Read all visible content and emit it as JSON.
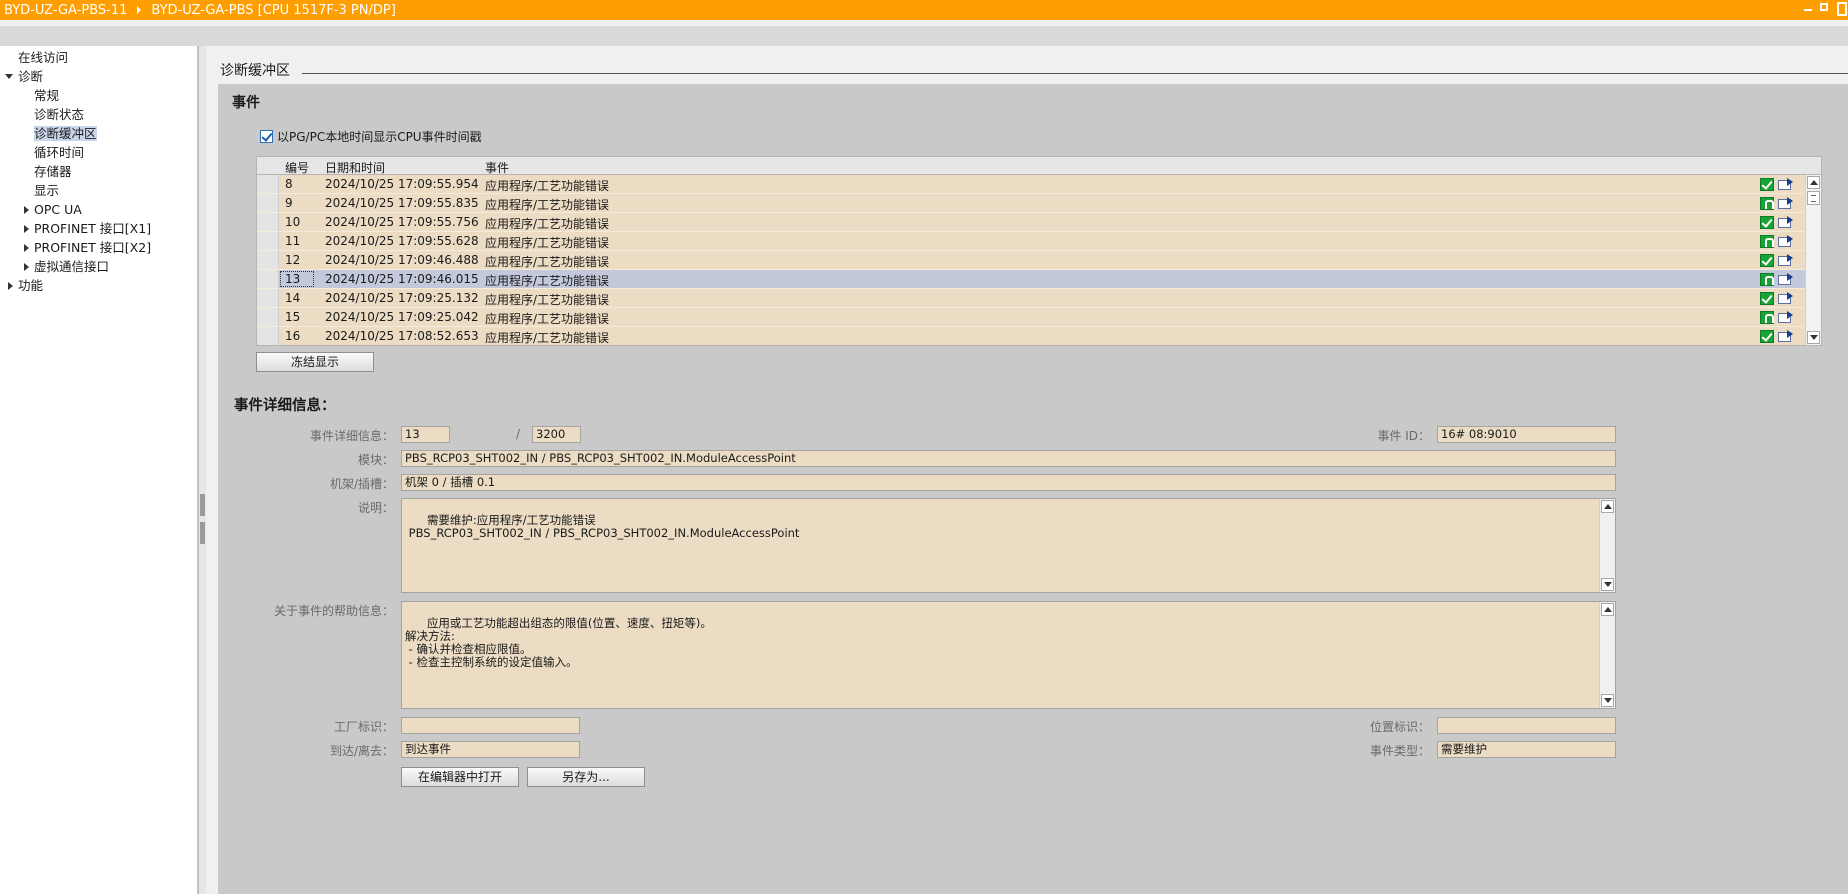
{
  "titlebar": {
    "crumb1": "BYD-UZ-GA-PBS-11",
    "crumb2": "BYD-UZ-GA-PBS [CPU 1517F-3 PN/DP]",
    "color": "#ff9e00"
  },
  "nav": {
    "items": [
      {
        "label": "在线访问"
      },
      {
        "label": "诊断"
      },
      {
        "label": "常规"
      },
      {
        "label": "诊断状态"
      },
      {
        "label": "诊断缓冲区"
      },
      {
        "label": "循环时间"
      },
      {
        "label": "存储器"
      },
      {
        "label": "显示"
      },
      {
        "label": "OPC UA"
      },
      {
        "label": "PROFINET 接口[X1]"
      },
      {
        "label": "PROFINET 接口[X2]"
      },
      {
        "label": "虚拟通信接口"
      },
      {
        "label": "功能"
      }
    ]
  },
  "content": {
    "section_title": "诊断缓冲区",
    "events_title": "事件",
    "local_time_checkbox": "以PG/PC本地时间显示CPU事件时间戳",
    "table": {
      "headers": {
        "no": "编号",
        "datetime": "日期和时间",
        "event": "事件"
      },
      "rows": [
        {
          "no": "8",
          "datetime": "2024/10/25 17:09:55.954",
          "event": "应用程序/工艺功能错误",
          "status": "ok"
        },
        {
          "no": "9",
          "datetime": "2024/10/25 17:09:55.835",
          "event": "应用程序/工艺功能错误",
          "status": "maint"
        },
        {
          "no": "10",
          "datetime": "2024/10/25 17:09:55.756",
          "event": "应用程序/工艺功能错误",
          "status": "ok"
        },
        {
          "no": "11",
          "datetime": "2024/10/25 17:09:55.628",
          "event": "应用程序/工艺功能错误",
          "status": "maint"
        },
        {
          "no": "12",
          "datetime": "2024/10/25 17:09:46.488",
          "event": "应用程序/工艺功能错误",
          "status": "ok"
        },
        {
          "no": "13",
          "datetime": "2024/10/25 17:09:46.015",
          "event": "应用程序/工艺功能错误",
          "status": "maint",
          "selected": true
        },
        {
          "no": "14",
          "datetime": "2024/10/25 17:09:25.132",
          "event": "应用程序/工艺功能错误",
          "status": "ok"
        },
        {
          "no": "15",
          "datetime": "2024/10/25 17:09:25.042",
          "event": "应用程序/工艺功能错误",
          "status": "maint"
        },
        {
          "no": "16",
          "datetime": "2024/10/25 17:08:52.653",
          "event": "应用程序/工艺功能错误",
          "status": "ok"
        }
      ]
    },
    "freeze_button": "冻结显示",
    "details": {
      "title": "事件详细信息：",
      "event_detail_label": "事件详细信息：",
      "event_index": "13",
      "slash": "/",
      "event_total": "3200",
      "event_id_label": "事件 ID：",
      "event_id": "16# 08:9010",
      "module_label": "模块：",
      "module": "PBS_RCP03_SHT002_IN / PBS_RCP03_SHT002_IN.ModuleAccessPoint",
      "rack_label": "机架/插槽：",
      "rack": "机架 0 / 插槽 0.1",
      "desc_label": "说明：",
      "desc": "需要维护:应用程序/工艺功能错误\n PBS_RCP03_SHT002_IN / PBS_RCP03_SHT002_IN.ModuleAccessPoint",
      "help_label": "关于事件的帮助信息：",
      "help": "应用或工艺功能超出组态的限值(位置、速度、扭矩等)。\n解决方法:\n - 确认并检查相应限值。\n - 检查主控制系统的设定值输入。",
      "plant_label": "工厂标识：",
      "plant": "",
      "location_label": "位置标识：",
      "location": "",
      "arrival_label": "到达/离去：",
      "arrival": "到达事件",
      "event_type_label": "事件类型：",
      "event_type": "需要维护",
      "open_editor_button": "在编辑器中打开",
      "save_as_button": "另存为..."
    }
  }
}
